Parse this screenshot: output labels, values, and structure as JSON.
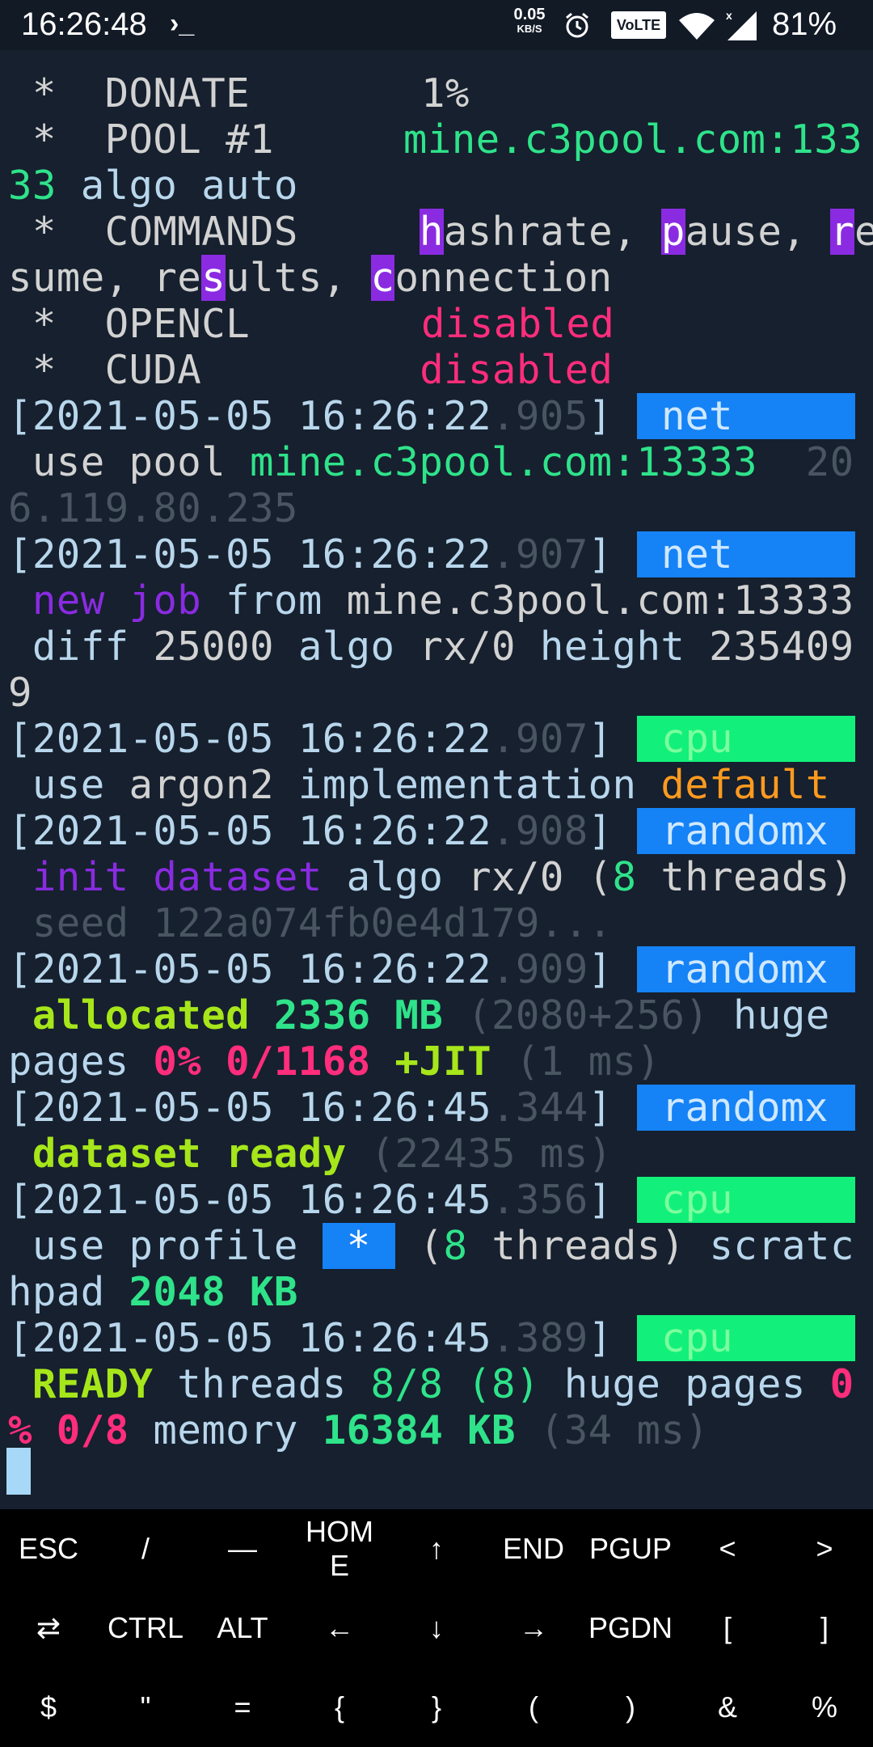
{
  "status_bar": {
    "time": "16:26:48",
    "prompt_glyph": "›_",
    "net_speed_value": "0.05",
    "net_speed_unit": "KB/S",
    "volte": "VoLTE",
    "battery": "81%"
  },
  "terminal": {
    "summary": {
      "donate_label": " *  DONATE",
      "donate_value": "1%",
      "pool_label": " *  POOL #1",
      "pool_value_a": "mine.c3pool.com:133",
      "pool_value_b": "33",
      "pool_algo": " algo auto",
      "commands_label": " *  COMMANDS",
      "cmd_h": "h",
      "cmd_ashrate": "ashrate, ",
      "cmd_p": "p",
      "cmd_ause": "ause, ",
      "cmd_r": "r",
      "cmd_e": "e",
      "cmd_sume": "sume, re",
      "cmd_s": "s",
      "cmd_ults": "ults, ",
      "cmd_c": "c",
      "cmd_onnection": "onnection",
      "opencl_label": " *  OPENCL",
      "opencl_value": "disabled",
      "cuda_label": " *  CUDA",
      "cuda_value": "disabled"
    },
    "logs": [
      {
        "ts": "[2021-05-05 16:26:22",
        "ms": ".905",
        "close": "]",
        "tag": "net",
        "l1_a": " use pool ",
        "l1_b": "mine.c3pool.com:13333",
        "l1_c": "  20",
        "l2_a": "6.119.80.235"
      },
      {
        "ts": "[2021-05-05 16:26:22",
        "ms": ".907",
        "close": "]",
        "tag": "net",
        "l1_a": " new job",
        "l1_b": " from ",
        "l1_c": "mine.c3pool.com:13333",
        "l2_a": " diff ",
        "l2_b": "25000",
        "l2_c": " algo ",
        "l2_d": "rx/0",
        "l2_e": " height ",
        "l2_f": "235409",
        "l3_a": "9"
      },
      {
        "ts": "[2021-05-05 16:26:22",
        "ms": ".907",
        "close": "]",
        "tag": "cpu",
        "l1_a": " use ",
        "l1_b": "argon2",
        "l1_c": " implementation ",
        "l1_d": "default"
      },
      {
        "ts": "[2021-05-05 16:26:22",
        "ms": ".908",
        "close": "]",
        "tag": "randomx",
        "l1_a": " init dataset",
        "l1_b": " algo ",
        "l1_c": "rx/0",
        "l1_d": " (",
        "l1_e": "8",
        "l1_f": " threads)",
        "l2_a": " seed 122a074fb0e4d179..."
      },
      {
        "ts": "[2021-05-05 16:26:22",
        "ms": ".909",
        "close": "]",
        "tag": "randomx",
        "l1_a": " allocated ",
        "l1_b": "2336 MB",
        "l1_c": " (2080+256)",
        "l1_d": " huge",
        "l2_a": "pages ",
        "l2_b": "0% 0/1168",
        "l2_c": " +JIT",
        "l2_d": " (1 ms)"
      },
      {
        "ts": "[2021-05-05 16:26:45",
        "ms": ".344",
        "close": "]",
        "tag": "randomx",
        "l1_a": " dataset ready",
        "l1_b": " (22435 ms)"
      },
      {
        "ts": "[2021-05-05 16:26:45",
        "ms": ".356",
        "close": "]",
        "tag": "cpu",
        "l1_a": " use profile ",
        "l1_b": "*",
        "l1_c": " (",
        "l1_d": "8",
        "l1_e": " threads)",
        "l1_f": " scratc",
        "l2_a": "hpad ",
        "l2_b": "2048 KB"
      },
      {
        "ts": "[2021-05-05 16:26:45",
        "ms": ".389",
        "close": "]",
        "tag": "cpu",
        "l1_a": " READY",
        "l1_b": " threads ",
        "l1_c": "8/8 (8)",
        "l1_d": " huge pages ",
        "l1_e": "0",
        "l2_a": "% 0/8",
        "l2_b": " memory ",
        "l2_c": "16384 KB",
        "l2_d": " (34 ms)"
      }
    ]
  },
  "extra_keys": {
    "row1": [
      "ESC",
      "/",
      "—",
      "HOM E",
      "↑",
      "END",
      "PGUP",
      "<",
      ">"
    ],
    "row2": [
      "⇄",
      "CTRL",
      "ALT",
      "←",
      "↓",
      "→",
      "PGDN",
      "[",
      "]"
    ],
    "row3": [
      "$",
      "\"",
      "=",
      "{",
      "}",
      "(",
      ")",
      "&",
      "%"
    ]
  },
  "colors": {
    "background": "#16202e",
    "tag_blue": "#1582f6",
    "tag_green": "#12f07b",
    "accent_green": "#2fe38a",
    "accent_pink": "#ff2d7c",
    "accent_purple": "#8a2be2"
  }
}
